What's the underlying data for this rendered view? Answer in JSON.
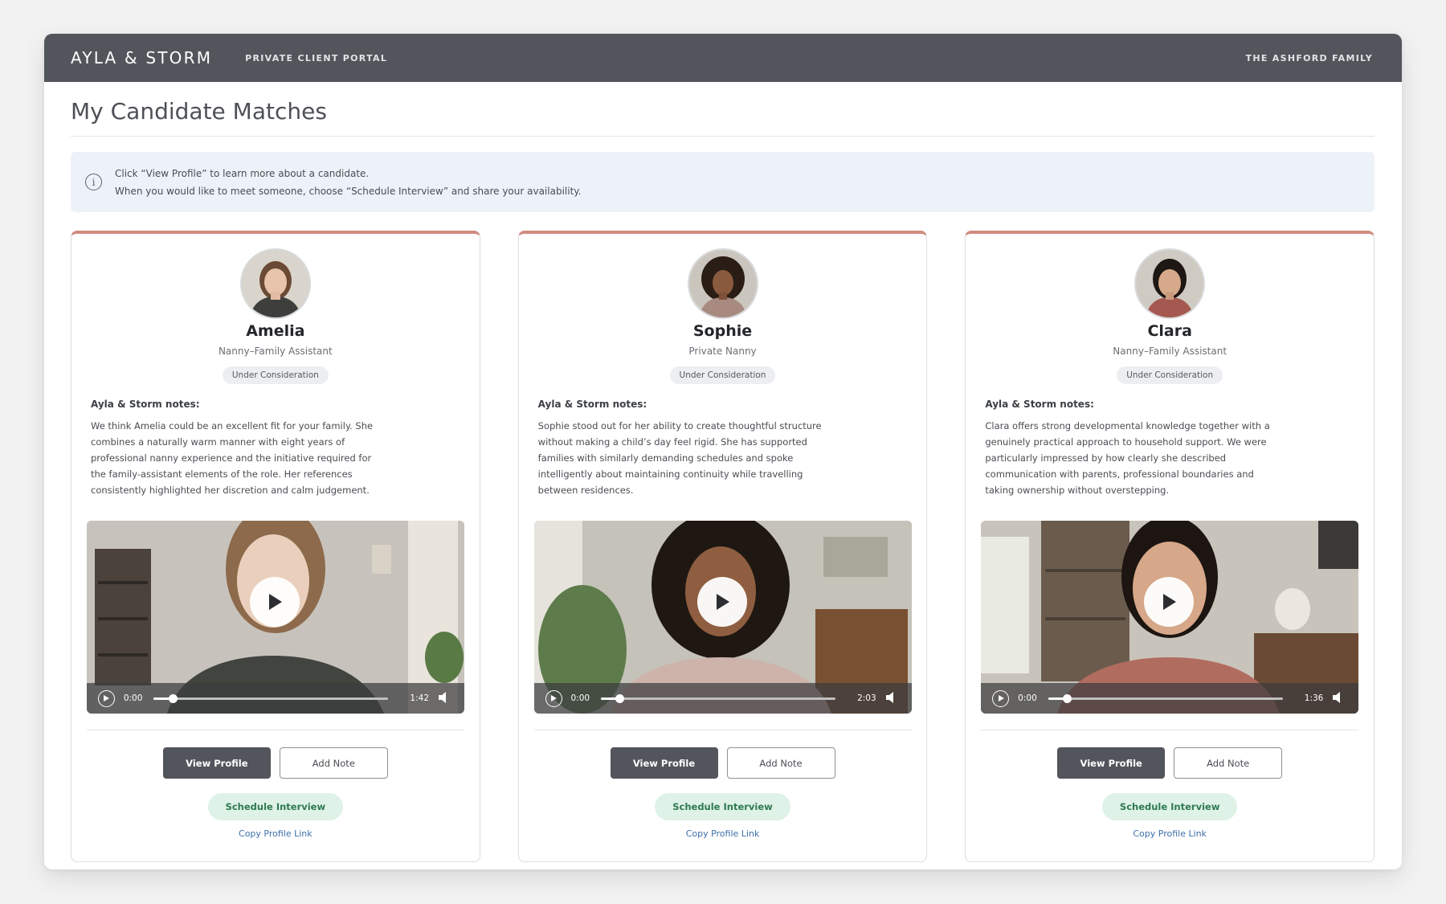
{
  "header": {
    "brand": "AYLA & STORM",
    "portal": "PRIVATE CLIENT PORTAL",
    "family": "THE ASHFORD FAMILY"
  },
  "page": {
    "title": "My Candidate Matches"
  },
  "info": {
    "line1": "Click “View Profile” to learn more about a candidate.",
    "line2": "When you would like to meet someone, choose “Schedule Interview” and share your availability."
  },
  "labels": {
    "notes_title": "Ayla & Storm notes:",
    "view_profile": "View Profile",
    "add_note": "Add Note",
    "schedule": "Schedule Interview",
    "copy_link": "Copy Profile Link"
  },
  "colors": {
    "topbar": "#52555b",
    "card_accent": "#cf8b7f",
    "schedule_bg": "#dff2e8",
    "schedule_text": "#2e7a50",
    "link": "#3d6fa8"
  },
  "candidates": [
    {
      "name": "Amelia",
      "role": "Nanny–Family Assistant",
      "status": "Under Consideration",
      "notes": "We think Amelia could be an excellent fit for your family. She combines a naturally warm manner with eight years of professional nanny experience and the initiative required for the family-assistant elements of the role. Her references consistently highlighted her discretion and calm judgement.",
      "video": {
        "current": "0:00",
        "duration": "1:42",
        "progress": 0.08
      }
    },
    {
      "name": "Sophie",
      "role": "Private Nanny",
      "status": "Under Consideration",
      "notes": "Sophie stood out for her ability to create thoughtful structure without making a child’s day feel rigid. She has supported families with similarly demanding schedules and spoke intelligently about maintaining continuity while travelling between residences.",
      "video": {
        "current": "0:00",
        "duration": "2:03",
        "progress": 0.08
      }
    },
    {
      "name": "Clara",
      "role": "Nanny–Family Assistant",
      "status": "Under Consideration",
      "notes": "Clara offers strong developmental knowledge together with a genuinely practical approach to household support. We were particularly impressed by how clearly she described communication with parents, professional boundaries and taking ownership without overstepping.",
      "video": {
        "current": "0:00",
        "duration": "1:36",
        "progress": 0.08
      }
    }
  ]
}
